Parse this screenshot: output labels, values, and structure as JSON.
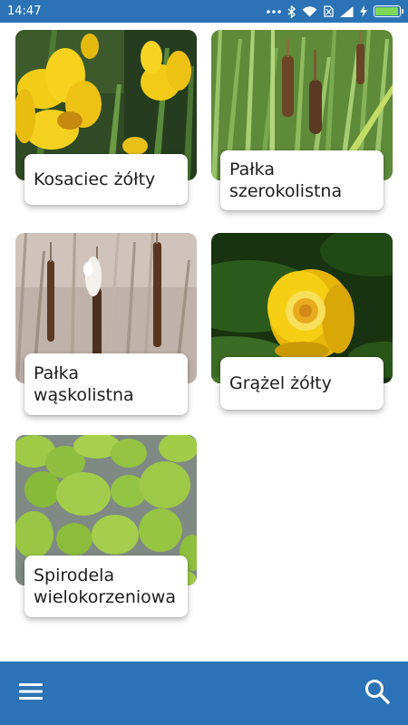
{
  "status_bar": {
    "time": "14:47",
    "icons": [
      "more-dots-icon",
      "bluetooth-icon",
      "wifi-icon",
      "no-sim-icon",
      "signal-icon",
      "charging-icon",
      "battery-icon"
    ],
    "battery_level": 0.95,
    "color": "#2b73b6"
  },
  "plants": [
    {
      "name": "Kosaciec żółty",
      "image": "yellow-iris-photo"
    },
    {
      "name": "Pałka szerokolistna",
      "image": "broadleaf-cattail-photo"
    },
    {
      "name": "Pałka wąskolistna",
      "image": "narrowleaf-cattail-photo"
    },
    {
      "name": "Grążel żółty",
      "image": "yellow-water-lily-photo"
    },
    {
      "name": "Spirodela wielokorzeniowa",
      "image": "duckweed-photo"
    }
  ],
  "bottom_bar": {
    "menu_icon": "hamburger-menu-icon",
    "search_icon": "search-icon",
    "color": "#2b73b6"
  }
}
